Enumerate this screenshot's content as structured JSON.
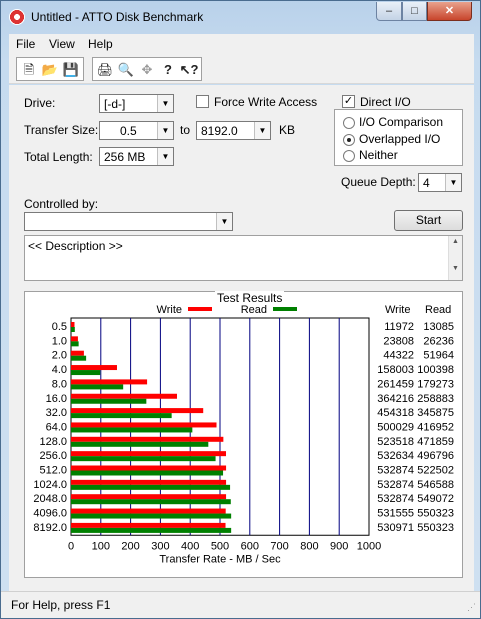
{
  "window": {
    "title": "Untitled - ATTO Disk Benchmark",
    "min": "–",
    "max": "□",
    "close": "✕"
  },
  "menu": [
    "File",
    "View",
    "Help"
  ],
  "toolbar": {
    "icons": [
      "new-icon",
      "open-icon",
      "save-icon",
      "print-icon",
      "print-preview-icon",
      "move-icon",
      "help-icon",
      "context-help-icon"
    ]
  },
  "form": {
    "drive_label": "Drive:",
    "drive_value": "[-d-]",
    "force_write_label": "Force Write Access",
    "direct_io_label": "Direct I/O",
    "direct_io_checked": true,
    "transfer_size_label": "Transfer Size:",
    "transfer_from": "0.5",
    "to_label": "to",
    "transfer_to": "8192.0",
    "kb_label": "KB",
    "total_length_label": "Total Length:",
    "total_length_value": "256 MB",
    "io_options": [
      "I/O Comparison",
      "Overlapped I/O",
      "Neither"
    ],
    "io_selected": 1,
    "queue_depth_label": "Queue Depth:",
    "queue_depth_value": "4",
    "controlled_by_label": "Controlled by:",
    "controlled_by_value": "",
    "start_label": "Start",
    "description": "<< Description >>"
  },
  "chart_data": {
    "type": "bar",
    "title": "Test Results",
    "xlabel": "Transfer Rate - MB / Sec",
    "xlim": [
      0,
      1000
    ],
    "xticks": [
      "0",
      "100",
      "200",
      "300",
      "400",
      "500",
      "600",
      "700",
      "800",
      "900",
      "1000"
    ],
    "legend": [
      "Write",
      "Read"
    ],
    "colors": {
      "write": "#ff0000",
      "read": "#008000",
      "grid": "#000080"
    },
    "categories": [
      "0.5",
      "1.0",
      "2.0",
      "4.0",
      "8.0",
      "16.0",
      "32.0",
      "64.0",
      "128.0",
      "256.0",
      "512.0",
      "1024.0",
      "2048.0",
      "4096.0",
      "8192.0"
    ],
    "series": [
      {
        "name": "Write",
        "values": [
          11972,
          23808,
          44322,
          158003,
          261459,
          364216,
          454318,
          500029,
          523518,
          532634,
          532874,
          532874,
          532874,
          531555,
          530971
        ]
      },
      {
        "name": "Read",
        "values": [
          13085,
          26236,
          51964,
          100398,
          179273,
          258883,
          345875,
          416952,
          471859,
          496796,
          522502,
          546588,
          549072,
          550323,
          550323
        ]
      }
    ],
    "value_unit_divisor": 1024,
    "col_headers": [
      "Write",
      "Read"
    ]
  },
  "status": "For Help, press F1"
}
